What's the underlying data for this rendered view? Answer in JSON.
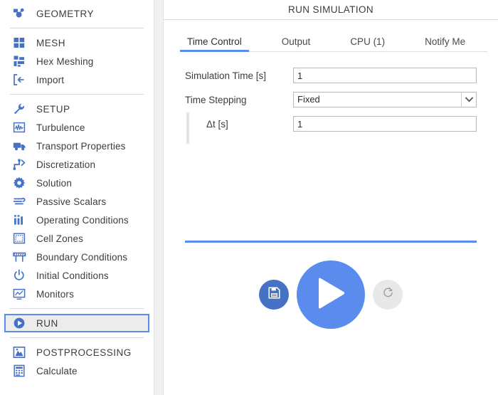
{
  "sidebar": {
    "groups": [
      {
        "items": [
          {
            "label": "GEOMETRY",
            "icon": "geometry-icon",
            "type": "header",
            "selected": false
          }
        ]
      },
      {
        "items": [
          {
            "label": "MESH",
            "icon": "mesh-grid-icon",
            "type": "header",
            "selected": false
          },
          {
            "label": "Hex Meshing",
            "icon": "hex-meshing-icon",
            "type": "item",
            "selected": false
          },
          {
            "label": "Import",
            "icon": "import-arrow-icon",
            "type": "item",
            "selected": false
          }
        ]
      },
      {
        "items": [
          {
            "label": "SETUP",
            "icon": "wrench-icon",
            "type": "header",
            "selected": false
          },
          {
            "label": "Turbulence",
            "icon": "turbulence-waveform-icon",
            "type": "item",
            "selected": false
          },
          {
            "label": "Transport Properties",
            "icon": "truck-icon",
            "type": "item",
            "selected": false
          },
          {
            "label": "Discretization",
            "icon": "discretization-steps-icon",
            "type": "item",
            "selected": false
          },
          {
            "label": "Solution",
            "icon": "gear-icon",
            "type": "item",
            "selected": false
          },
          {
            "label": "Passive Scalars",
            "icon": "passive-scalars-flow-icon",
            "type": "item",
            "selected": false
          },
          {
            "label": "Operating Conditions",
            "icon": "bar-chart-icon",
            "type": "item",
            "selected": false
          },
          {
            "label": "Cell Zones",
            "icon": "cell-zones-dashed-square-icon",
            "type": "item",
            "selected": false
          },
          {
            "label": "Boundary Conditions",
            "icon": "boundary-barrier-icon",
            "type": "item",
            "selected": false
          },
          {
            "label": "Initial Conditions",
            "icon": "power-icon",
            "type": "item",
            "selected": false
          },
          {
            "label": "Monitors",
            "icon": "monitor-chart-icon",
            "type": "item",
            "selected": false
          }
        ]
      },
      {
        "items": [
          {
            "label": "RUN",
            "icon": "play-circle-icon",
            "type": "header",
            "selected": true
          }
        ]
      },
      {
        "items": [
          {
            "label": "POSTPROCESSING",
            "icon": "postprocessing-image-icon",
            "type": "header",
            "selected": false
          },
          {
            "label": "Calculate",
            "icon": "calculator-icon",
            "type": "item",
            "selected": false
          }
        ]
      }
    ]
  },
  "panel": {
    "title": "RUN SIMULATION",
    "tabs": [
      {
        "label": "Time Control",
        "active": true
      },
      {
        "label": "Output",
        "active": false
      },
      {
        "label": "CPU  (1)",
        "active": false
      },
      {
        "label": "Notify Me",
        "active": false
      }
    ],
    "form": {
      "simulation_time_label": "Simulation Time [s]",
      "simulation_time_value": "1",
      "time_stepping_label": "Time Stepping",
      "time_stepping_value": "Fixed",
      "delta_t_label": "Δt [s]",
      "delta_t_value": "1"
    },
    "actions": {
      "save_label": "save-button",
      "run_label": "run-button",
      "reset_label": "reset-button"
    }
  },
  "colors": {
    "accent": "#5b8ced",
    "icon_blue": "#4572c4",
    "selected_bg": "#ececec",
    "reset_bg": "#e8e8e8"
  }
}
